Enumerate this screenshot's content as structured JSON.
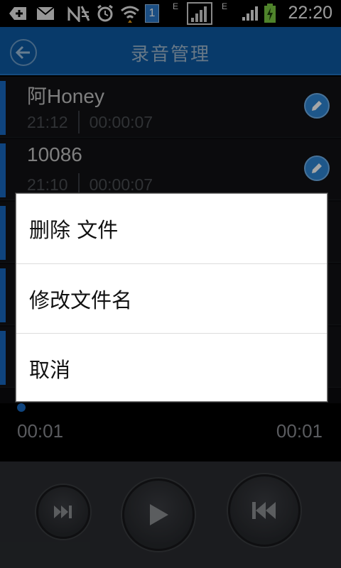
{
  "status_bar": {
    "time": "22:20",
    "notification_badge": "1",
    "network_type_1": "E",
    "network_type_2": "E",
    "icons": [
      "add-icon",
      "email-icon",
      "no-signal-icon",
      "alarm-icon",
      "wifi-icon",
      "notification-badge",
      "signal-icon",
      "signal-icon",
      "battery-charging-icon"
    ]
  },
  "app_bar": {
    "title": "录音管理",
    "back_icon": "back-arrow-icon",
    "color": "#0d5aa3"
  },
  "recordings": [
    {
      "name": "阿Honey",
      "time": "21:12",
      "duration": "00:00:07"
    },
    {
      "name": "10086",
      "time": "21:10",
      "duration": "00:00:07"
    }
  ],
  "player": {
    "elapsed": "00:01",
    "total": "00:01",
    "controls": [
      "next-icon",
      "play-icon",
      "previous-icon"
    ]
  },
  "context_menu": {
    "items": [
      "删除  文件",
      "修改文件名",
      "取消"
    ]
  }
}
